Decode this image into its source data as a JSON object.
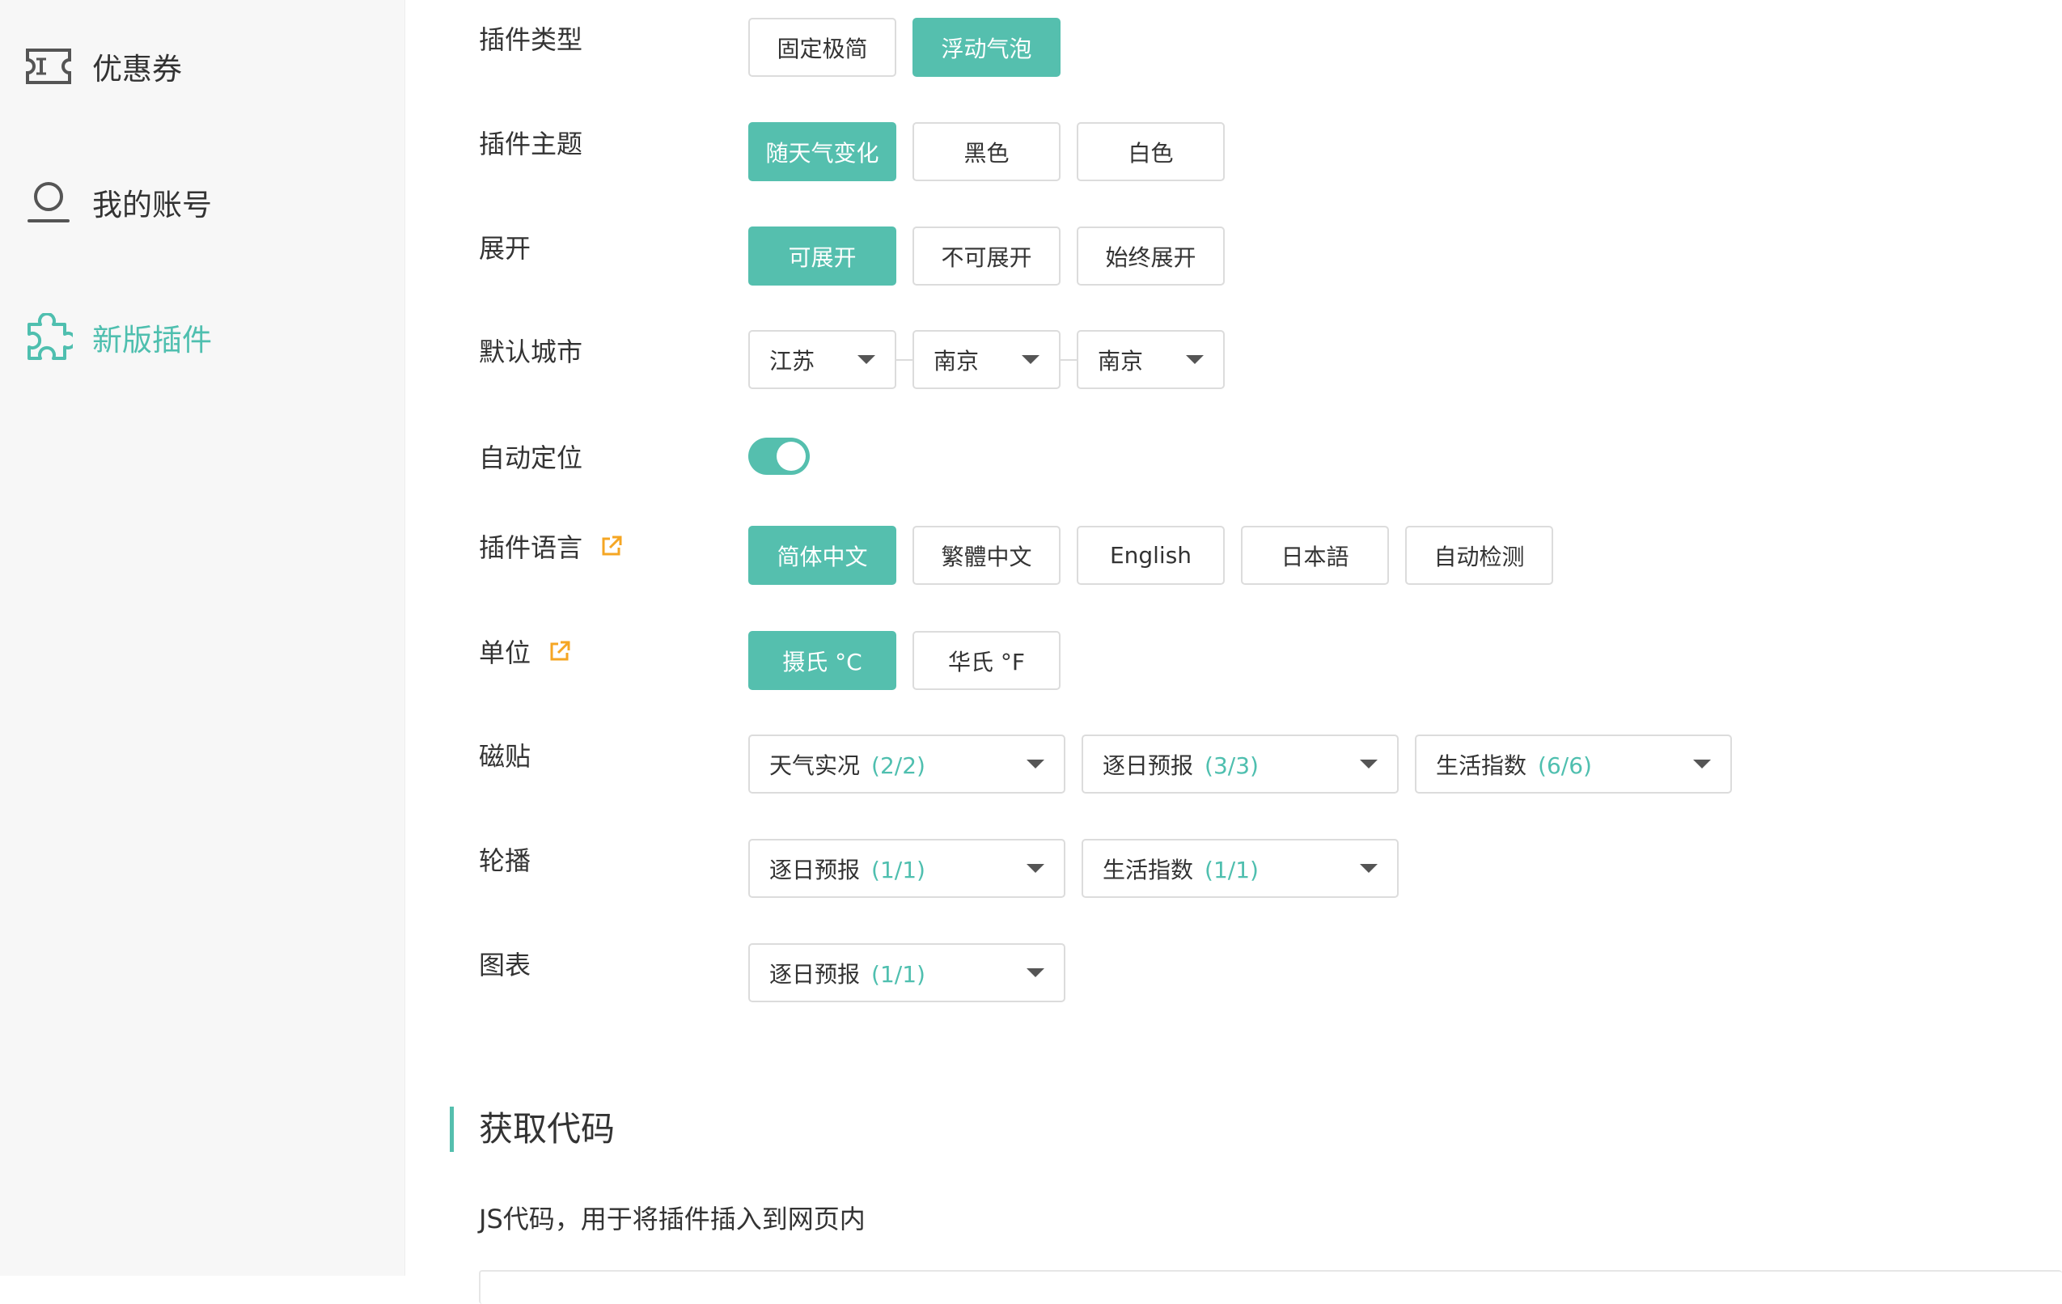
{
  "sidebar": {
    "items": [
      {
        "label": "优惠券",
        "icon": "coupon-icon"
      },
      {
        "label": "我的账号",
        "icon": "user-icon"
      },
      {
        "label": "新版插件",
        "icon": "puzzle-icon"
      }
    ],
    "active": "新版插件"
  },
  "settings": {
    "plugin_type": {
      "label": "插件类型",
      "options": [
        "固定极简",
        "浮动气泡"
      ],
      "selected": "浮动气泡"
    },
    "plugin_theme": {
      "label": "插件主题",
      "options": [
        "随天气变化",
        "黑色",
        "白色"
      ],
      "selected": "随天气变化"
    },
    "expand": {
      "label": "展开",
      "options": [
        "可展开",
        "不可展开",
        "始终展开"
      ],
      "selected": "可展开"
    },
    "default_city": {
      "label": "默认城市",
      "province": "江苏",
      "city": "南京",
      "district": "南京"
    },
    "auto_locate": {
      "label": "自动定位",
      "enabled": true
    },
    "language": {
      "label": "插件语言",
      "options": [
        "简体中文",
        "繁體中文",
        "English",
        "日本語",
        "自动检测"
      ],
      "selected": "简体中文"
    },
    "unit": {
      "label": "单位",
      "options": [
        "摄氏 °C",
        "华氏 °F"
      ],
      "selected": "摄氏 °C"
    },
    "tiles": {
      "label": "磁贴",
      "selects": [
        {
          "text": "天气实况",
          "count": "(2/2)"
        },
        {
          "text": "逐日预报",
          "count": "(3/3)"
        },
        {
          "text": "生活指数",
          "count": "(6/6)"
        }
      ]
    },
    "carousel": {
      "label": "轮播",
      "selects": [
        {
          "text": "逐日预报",
          "count": "(1/1)"
        },
        {
          "text": "生活指数",
          "count": "(1/1)"
        }
      ]
    },
    "chart": {
      "label": "图表",
      "selects": [
        {
          "text": "逐日预报",
          "count": "(1/1)"
        }
      ]
    }
  },
  "get_code": {
    "title": "获取代码",
    "description": "JS代码，用于将插件插入到网页内"
  },
  "colors": {
    "accent": "#55bfae",
    "external_link": "#f5a623"
  }
}
